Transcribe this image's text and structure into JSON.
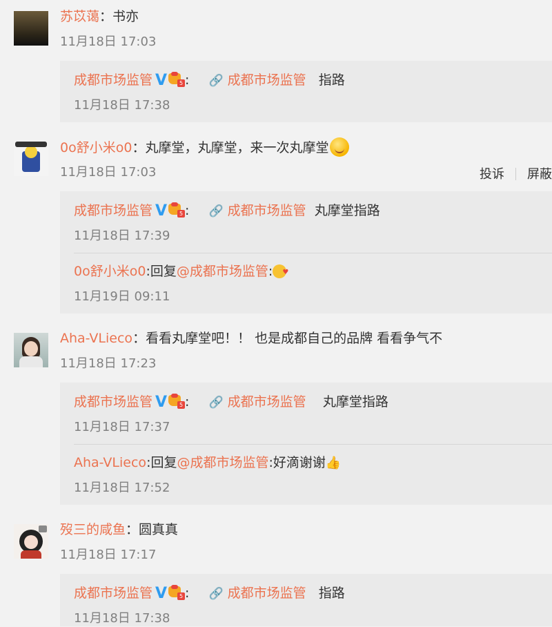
{
  "comments": [
    {
      "user": "苏苡蔼",
      "text": "书亦",
      "time": "11月18日 17:03",
      "replies": [
        {
          "user": "成都市场监管",
          "link": "成都市场监管",
          "text": "指路",
          "time": "11月18日 17:38"
        }
      ]
    },
    {
      "user": "0o舒小米o0",
      "text": "丸摩堂，丸摩堂，来一次丸摩堂",
      "time": "11月18日 17:03",
      "actions": {
        "report": "投诉",
        "block": "屏蔽"
      },
      "replies": [
        {
          "user": "成都市场监管",
          "link": "成都市场监管",
          "text": "丸摩堂指路",
          "time": "11月18日 17:39"
        },
        {
          "user": "0o舒小米o0",
          "prefix": "回复",
          "mention": "@成都市场监管",
          "text": ":",
          "time": "11月19日 09:11"
        }
      ]
    },
    {
      "user": "Aha-VLieco",
      "text": "看看丸摩堂吧！！ 也是成都自己的品牌 看看争气不",
      "time": "11月18日 17:23",
      "replies": [
        {
          "user": "成都市场监管",
          "link": "成都市场监管",
          "text": "丸摩堂指路",
          "time": "11月18日 17:37"
        },
        {
          "user": "Aha-VLieco",
          "prefix": "回复",
          "mention": "@成都市场监管",
          "text": ":好滴谢谢",
          "time": "11月18日 17:52"
        }
      ]
    },
    {
      "user": "歿三的咸鱼",
      "text": "圆真真",
      "time": "11月18日 17:17",
      "replies": [
        {
          "user": "成都市场监管",
          "link": "成都市场监管",
          "text": "指路",
          "time": "11月18日 17:38"
        }
      ]
    }
  ],
  "colon": "：",
  "reply_colon": ":",
  "icons": {
    "verified": "V",
    "crown_level": "5",
    "link": "🔗",
    "thumb": "👍"
  },
  "colors": {
    "username": "#eb7350",
    "verified": "#2f9cf0",
    "timestamp": "#808080",
    "reply_bg": "#eaeaea",
    "page_bg": "#f2f2f2"
  }
}
